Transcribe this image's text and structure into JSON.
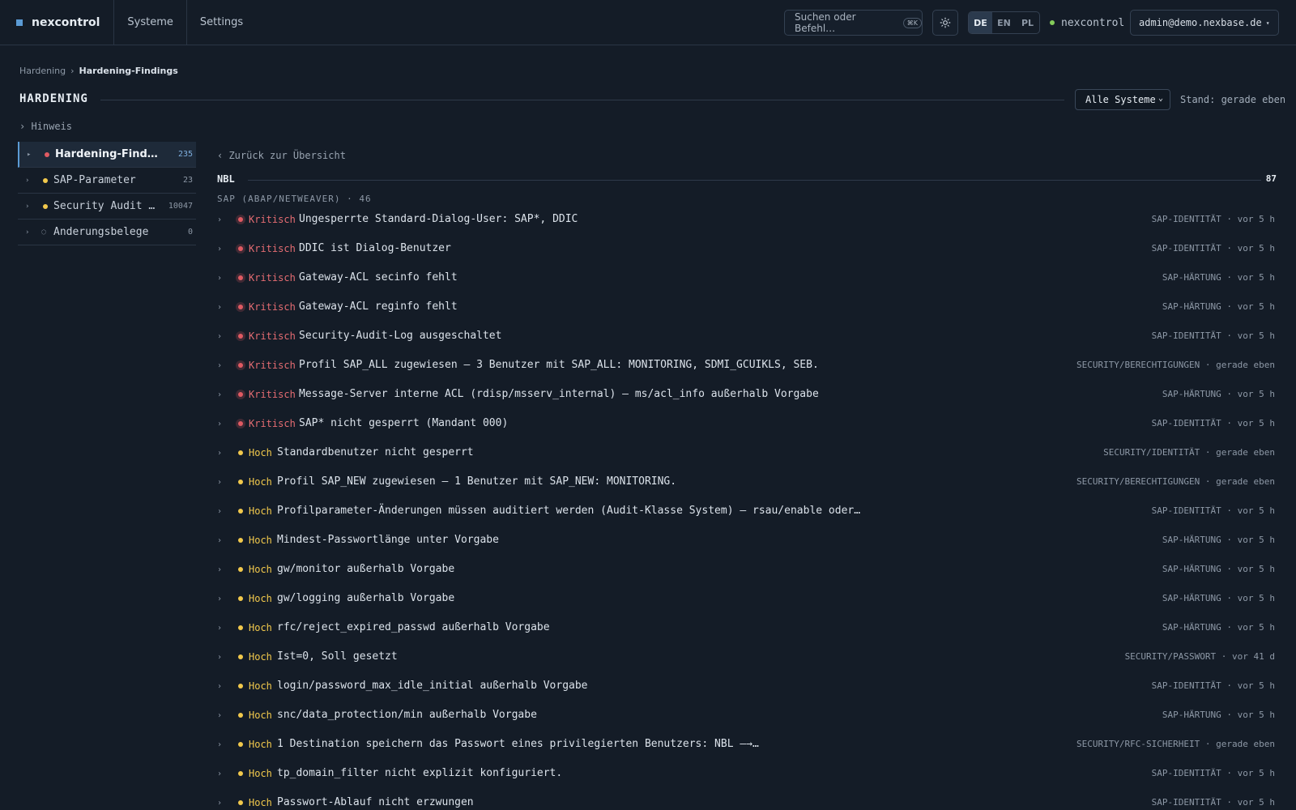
{
  "app": {
    "name": "nexcontrol",
    "nav": [
      "Systeme",
      "Settings"
    ],
    "search_placeholder": "Suchen oder Befehl…",
    "search_shortcut": "⌘K",
    "languages": [
      "DE",
      "EN",
      "PL"
    ],
    "active_language": "DE",
    "status_label": "nexcontrol",
    "status_color": "#84cc5a",
    "user": "admin@demo.nexbase.de"
  },
  "breadcrumb": {
    "root": "Hardening",
    "current": "Hardening-Findings"
  },
  "header": {
    "title": "HARDENING",
    "system_filter": "Alle Systeme",
    "stand": "Stand: gerade eben",
    "hint": "› Hinweis"
  },
  "sidebar": {
    "items": [
      {
        "label": "Hardening-Findings",
        "count": "235",
        "dot": "#e05a62"
      },
      {
        "label": "SAP-Parameter",
        "count": "23",
        "dot": "#f2c94c"
      },
      {
        "label": "Security Audit Log",
        "count": "10047",
        "dot": "#f2c94c"
      },
      {
        "label": "Änderungsbelege",
        "count": "0",
        "icon": "loading-icon"
      }
    ]
  },
  "main": {
    "back_label": "‹ Zurück zur Übersicht",
    "system": "NBL",
    "system_count": "87",
    "group_label": "SAP (ABAP/NETWEAVER) · 46",
    "findings": [
      {
        "severity": "Kritisch",
        "level": "crit",
        "title": "Ungesperrte Standard-Dialog-User: SAP*, DDIC",
        "meta": "SAP-IDENTITÄT · vor 5 h"
      },
      {
        "severity": "Kritisch",
        "level": "crit",
        "title": "DDIC ist Dialog-Benutzer",
        "meta": "SAP-IDENTITÄT · vor 5 h"
      },
      {
        "severity": "Kritisch",
        "level": "crit",
        "title": "Gateway-ACL secinfo fehlt",
        "meta": "SAP-HÄRTUNG · vor 5 h"
      },
      {
        "severity": "Kritisch",
        "level": "crit",
        "title": "Gateway-ACL reginfo fehlt",
        "meta": "SAP-HÄRTUNG · vor 5 h"
      },
      {
        "severity": "Kritisch",
        "level": "crit",
        "title": "Security-Audit-Log ausgeschaltet",
        "meta": "SAP-IDENTITÄT · vor 5 h"
      },
      {
        "severity": "Kritisch",
        "level": "crit",
        "title": "Profil SAP_ALL zugewiesen — 3 Benutzer mit SAP_ALL: MONITORING, SDMI_GCUIKLS, SEB.",
        "meta": "SECURITY/BERECHTIGUNGEN · gerade eben"
      },
      {
        "severity": "Kritisch",
        "level": "crit",
        "title": "Message-Server interne ACL (rdisp/msserv_internal) — ms/acl_info außerhalb Vorgabe",
        "meta": "SAP-HÄRTUNG · vor 5 h"
      },
      {
        "severity": "Kritisch",
        "level": "crit",
        "title": "SAP* nicht gesperrt (Mandant 000)",
        "meta": "SAP-IDENTITÄT · vor 5 h"
      },
      {
        "severity": "Hoch",
        "level": "high",
        "title": "Standardbenutzer nicht gesperrt",
        "meta": "SECURITY/IDENTITÄT · gerade eben"
      },
      {
        "severity": "Hoch",
        "level": "high",
        "title": "Profil SAP_NEW zugewiesen — 1 Benutzer mit SAP_NEW: MONITORING.",
        "meta": "SECURITY/BERECHTIGUNGEN · gerade eben"
      },
      {
        "severity": "Hoch",
        "level": "high",
        "title": "Profilparameter-Änderungen müssen auditiert werden (Audit-Klasse System) — rsau/enable oder…",
        "meta": "SAP-IDENTITÄT · vor 5 h"
      },
      {
        "severity": "Hoch",
        "level": "high",
        "title": "Mindest-Passwortlänge unter Vorgabe",
        "meta": "SAP-HÄRTUNG · vor 5 h"
      },
      {
        "severity": "Hoch",
        "level": "high",
        "title": "gw/monitor außerhalb Vorgabe",
        "meta": "SAP-HÄRTUNG · vor 5 h"
      },
      {
        "severity": "Hoch",
        "level": "high",
        "title": "gw/logging außerhalb Vorgabe",
        "meta": "SAP-HÄRTUNG · vor 5 h"
      },
      {
        "severity": "Hoch",
        "level": "high",
        "title": "rfc/reject_expired_passwd außerhalb Vorgabe",
        "meta": "SAP-HÄRTUNG · vor 5 h"
      },
      {
        "severity": "Hoch",
        "level": "high",
        "title": "Ist=0, Soll gesetzt",
        "meta": "SECURITY/PASSWORT · vor 41 d"
      },
      {
        "severity": "Hoch",
        "level": "high",
        "title": "login/password_max_idle_initial außerhalb Vorgabe",
        "meta": "SAP-IDENTITÄT · vor 5 h"
      },
      {
        "severity": "Hoch",
        "level": "high",
        "title": "snc/data_protection/min außerhalb Vorgabe",
        "meta": "SAP-HÄRTUNG · vor 5 h"
      },
      {
        "severity": "Hoch",
        "level": "high",
        "title": "1 Destination speichern das Passwort eines privilegierten Benutzers: NBL —→…",
        "meta": "SECURITY/RFC-SICHERHEIT · gerade eben"
      },
      {
        "severity": "Hoch",
        "level": "high",
        "title": "tp_domain_filter nicht explizit konfiguriert.",
        "meta": "SAP-IDENTITÄT · vor 5 h"
      },
      {
        "severity": "Hoch",
        "level": "high",
        "title": "Passwort-Ablauf nicht erzwungen",
        "meta": "SAP-IDENTITÄT · vor 5 h"
      }
    ]
  }
}
